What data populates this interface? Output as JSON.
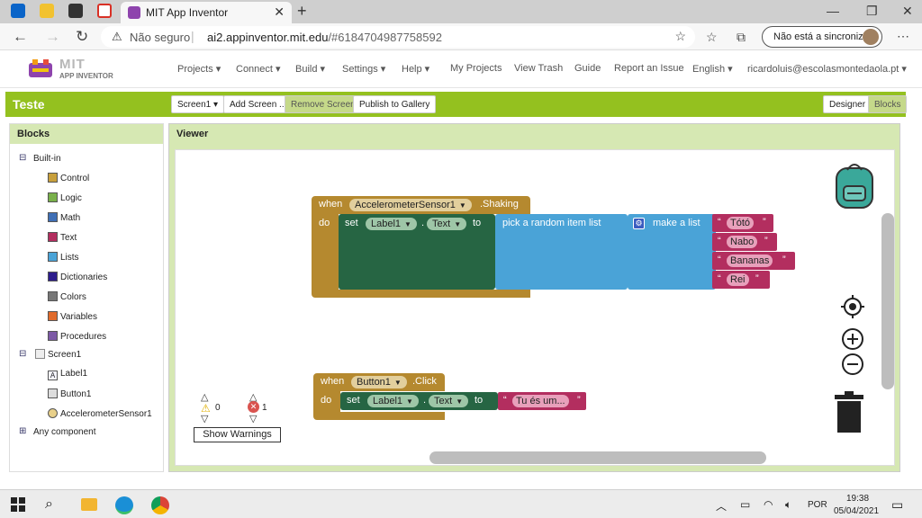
{
  "browser": {
    "tab_title": "MIT App Inventor",
    "not_secure": "Não seguro",
    "url_host": "ai2.appinventor.mit.edu",
    "url_path": "/#6184704987758592",
    "sync_label": "Não está a sincronizar"
  },
  "nav": {
    "logo_mit": "MIT",
    "logo_sub": "APP INVENTOR",
    "menus": [
      "Projects",
      "Connect",
      "Build",
      "Settings",
      "Help"
    ],
    "links": [
      "My Projects",
      "View Trash",
      "Guide",
      "Report an Issue"
    ],
    "language": "English",
    "user": "ricardoluis@escolasmontedaola.pt"
  },
  "toolbar": {
    "project": "Teste",
    "screen": "Screen1",
    "add_screen": "Add Screen ...",
    "remove_screen": "Remove Screen",
    "publish": "Publish to Gallery",
    "designer": "Designer",
    "blocks": "Blocks"
  },
  "blocks_panel": {
    "title": "Blocks",
    "builtin": "Built-in",
    "categories": [
      {
        "label": "Control",
        "color": "#c8a03c"
      },
      {
        "label": "Logic",
        "color": "#79b04a"
      },
      {
        "label": "Math",
        "color": "#3f6fb5"
      },
      {
        "label": "Text",
        "color": "#b32e5f"
      },
      {
        "label": "Lists",
        "color": "#4aa3d7"
      },
      {
        "label": "Dictionaries",
        "color": "#2c1c8c"
      },
      {
        "label": "Colors",
        "color": "#777777"
      },
      {
        "label": "Variables",
        "color": "#e06b2c"
      },
      {
        "label": "Procedures",
        "color": "#7d5aa6"
      }
    ],
    "screen": "Screen1",
    "components": [
      "Label1",
      "Button1",
      "AccelerometerSensor1"
    ],
    "any": "Any component"
  },
  "viewer": {
    "title": "Viewer",
    "block1": {
      "when": "when",
      "component": "AccelerometerSensor1",
      "event": ".Shaking",
      "do": "do",
      "set": "set",
      "target": "Label1",
      "dot": ".",
      "prop": "Text",
      "to": "to",
      "pick": "pick a random item  list",
      "make": "make a list",
      "items": [
        "Tótó",
        "Nabo",
        "Bananas",
        "Rei"
      ]
    },
    "block2": {
      "when": "when",
      "component": "Button1",
      "event": ".Click",
      "do": "do",
      "set": "set",
      "target": "Label1",
      "dot": ".",
      "prop": "Text",
      "to": "to",
      "text": "Tu és um..."
    },
    "warnings": "0",
    "errors": "1",
    "show_warnings": "Show Warnings"
  },
  "taskbar": {
    "lang": "POR",
    "time": "19:38",
    "date": "05/04/2021"
  }
}
